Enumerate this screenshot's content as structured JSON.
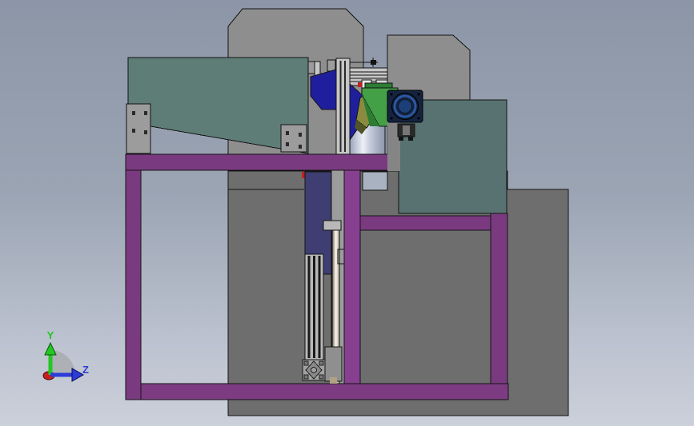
{
  "viewport": {
    "kind": "cad-3d-model-view",
    "model": "machine-assembly-side-view"
  },
  "triad": {
    "y_label": "Y",
    "z_label": "Z",
    "y_color": "#22c722",
    "z_color": "#2c3cd6",
    "origin_color": "#c42020",
    "arc_color": "#a8aaad"
  },
  "palette": {
    "bg_top": "#8c96a7",
    "bg_bottom": "#cbd0da",
    "body_light": "#8e8e8e",
    "body_dark": "#6e6e6e",
    "teal_left": "#5e7d77",
    "teal_right": "#577271",
    "frame": "#7a3a80",
    "frame_mid": "#874090",
    "frame_bottom": "#7d3c82",
    "bracket_gray": "#9c9c9c",
    "navy": "#1f1f9d",
    "indigo": "#3e3e73",
    "green": "#44a047",
    "green_dark": "#2c7c33",
    "olive": "#8b8b40",
    "olive_dark": "#4f5526",
    "motor": "#16233f",
    "motor_ring": "#2c57a0",
    "motor_core": "#1c3f77",
    "cylinder_cap": "#d5d7de",
    "alu_light": "#c6c6c6",
    "alu_mid": "#b8b8b8",
    "gap_bg": "#a9b2c1",
    "backing_gray": "#9c9c9c",
    "block_gray": "#8f8f8f",
    "strip_gray": "#858585",
    "red": "#c42020",
    "white_part": "#e8e8e8",
    "light_part": "#d8d8d8",
    "endcap": "#a2a2a2",
    "rod_tip": "#b0a183"
  }
}
